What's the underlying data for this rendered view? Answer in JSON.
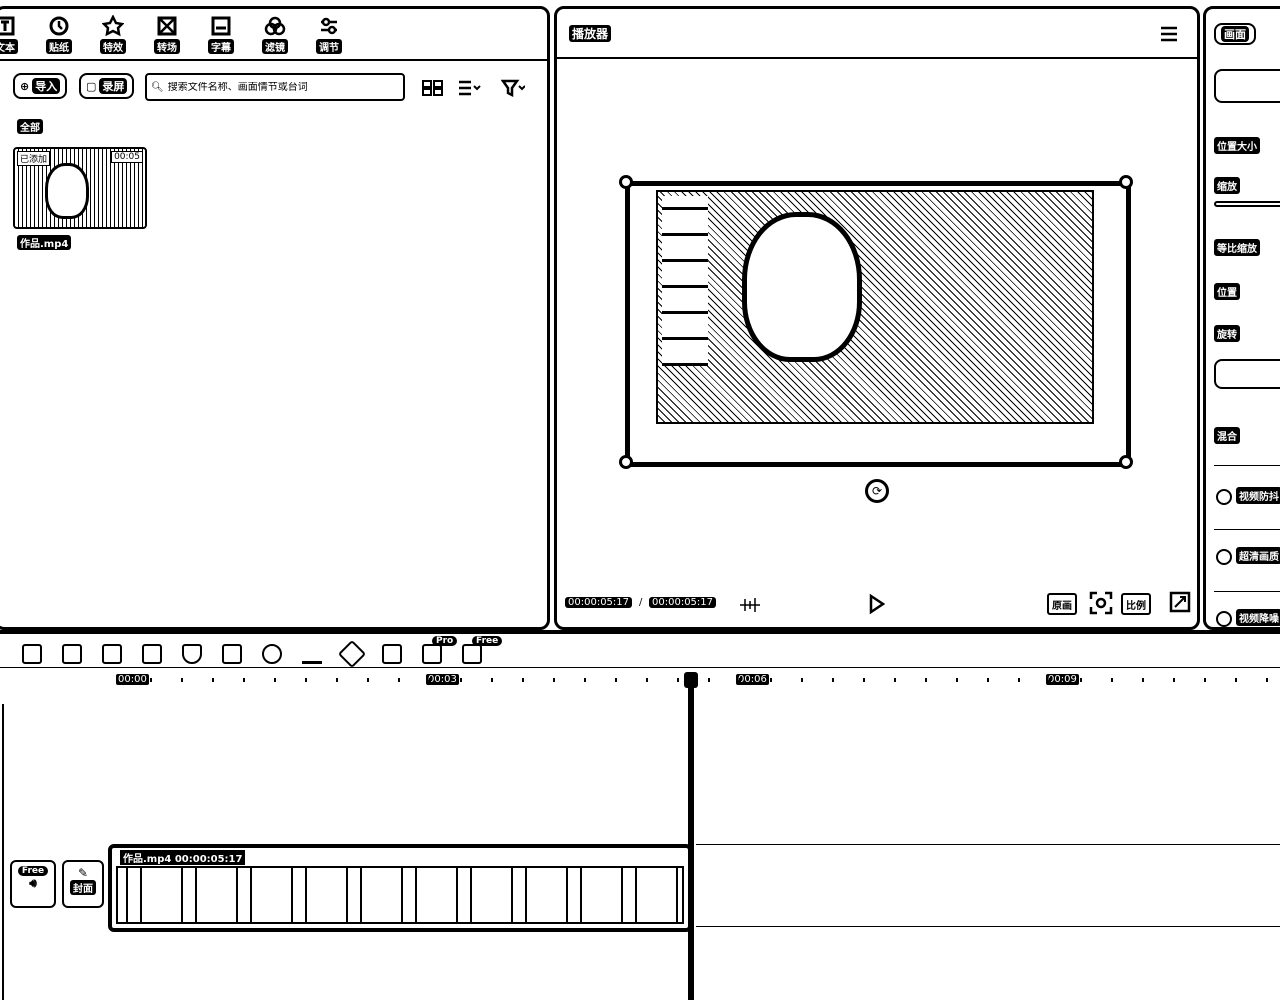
{
  "media_panel": {
    "categories": [
      {
        "icon": "text-icon",
        "label": "文本"
      },
      {
        "icon": "sticker-icon",
        "label": "贴纸"
      },
      {
        "icon": "effect-icon",
        "label": "特效"
      },
      {
        "icon": "transition-icon",
        "label": "转场"
      },
      {
        "icon": "subtitle-icon",
        "label": "字幕"
      },
      {
        "icon": "filter-icon",
        "label": "滤镜"
      },
      {
        "icon": "adjust-icon",
        "label": "调节"
      }
    ],
    "import_label": "导入",
    "record_label": "录屏",
    "search_placeholder": "搜索文件名称、画面情节或台词",
    "filter_all": "全部",
    "items": [
      {
        "added": "已添加",
        "duration": "00:05",
        "name": "作品.mp4"
      }
    ]
  },
  "player": {
    "title": "播放器",
    "current_time": "00:00:05:17",
    "separator": "/",
    "total_time": "00:00:05:17",
    "btn_original": "原画",
    "btn_ratio": "比例"
  },
  "properties": {
    "tab": "画面",
    "position_size": "位置大小",
    "scale": "缩放",
    "uniform_scale": "等比缩放",
    "position": "位置",
    "rotation": "旋转",
    "blend": "混合",
    "stabilize": "视频防抖",
    "hd": "超清画质",
    "denoise": "视频降噪"
  },
  "timeline": {
    "badge_pro": "Pro",
    "badge_free": "Free",
    "ruler": [
      "00:00",
      "00:03",
      "00:06",
      "00:09"
    ],
    "clip_label": "作品.mp4  00:00:05:17",
    "side_free": "Free",
    "side_cover": "封面"
  }
}
